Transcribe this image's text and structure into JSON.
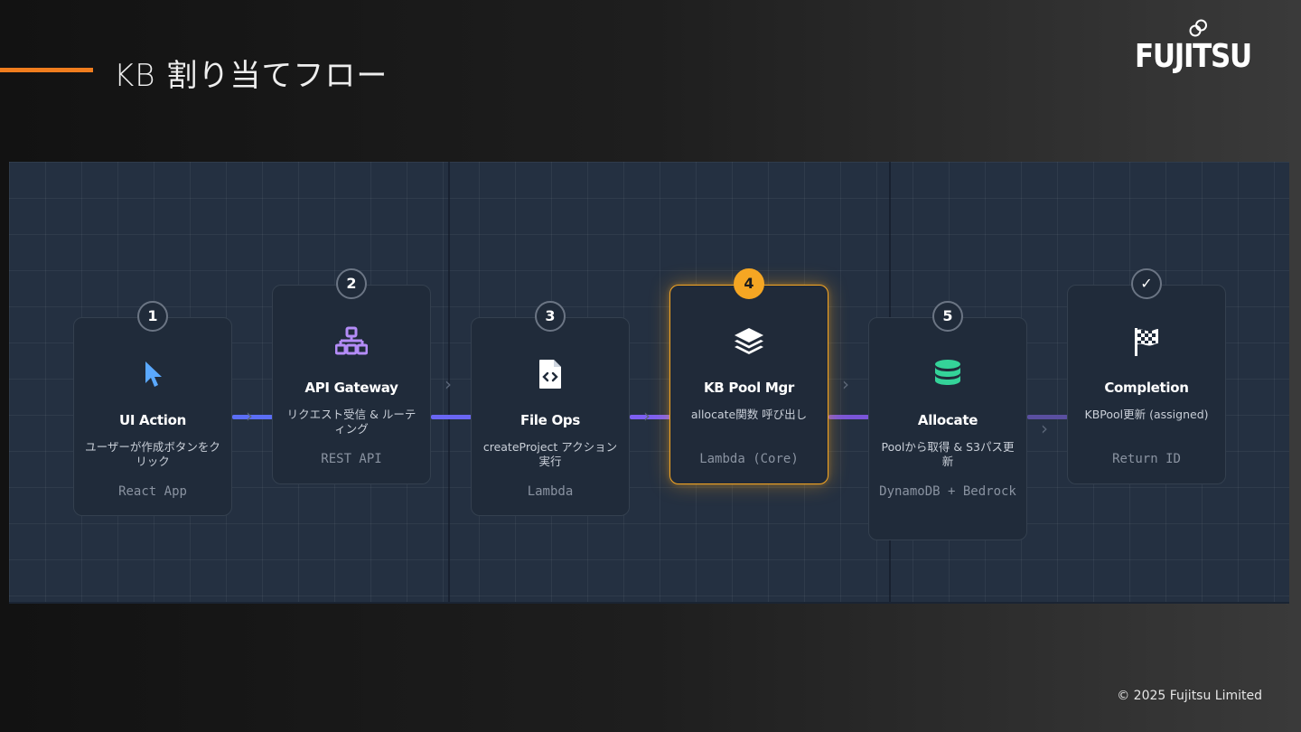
{
  "header": {
    "title": "KB 割り当てフロー",
    "logo_text": "FUJITSU"
  },
  "footer": {
    "copyright": "© 2025 Fujitsu Limited"
  },
  "colors": {
    "accent_orange": "#f07d1e",
    "active_step": "#f5a623",
    "connector_start": "#5b6ef5",
    "connector_mid": "#8b5cf6",
    "icon_cursor": "#5aa9ff",
    "icon_network": "#b48cf7",
    "icon_database": "#34d399"
  },
  "steps": [
    {
      "badge": "1",
      "icon": "cursor-pointer-icon",
      "title": "UI Action",
      "desc": "ユーザーが作成ボタンをクリック",
      "tech": "React App",
      "active": false
    },
    {
      "badge": "2",
      "icon": "network-sitemap-icon",
      "title": "API Gateway",
      "desc": "リクエスト受信 & ルーティング",
      "tech": "REST API",
      "active": false
    },
    {
      "badge": "3",
      "icon": "code-file-icon",
      "title": "File Ops",
      "desc": "createProject アクション実行",
      "tech": "Lambda",
      "active": false
    },
    {
      "badge": "4",
      "icon": "layers-stack-icon",
      "title": "KB Pool Mgr",
      "desc": "allocate関数 呼び出し",
      "tech": "Lambda (Core)",
      "active": true
    },
    {
      "badge": "5",
      "icon": "database-icon",
      "title": "Allocate",
      "desc": "Poolから取得 & S3パス更新",
      "tech": "DynamoDB + Bedrock",
      "active": false
    },
    {
      "badge": "✓",
      "icon": "checkered-flag-icon",
      "title": "Completion",
      "desc": "KBPool更新 (assigned)",
      "tech": "Return ID",
      "active": false
    }
  ]
}
